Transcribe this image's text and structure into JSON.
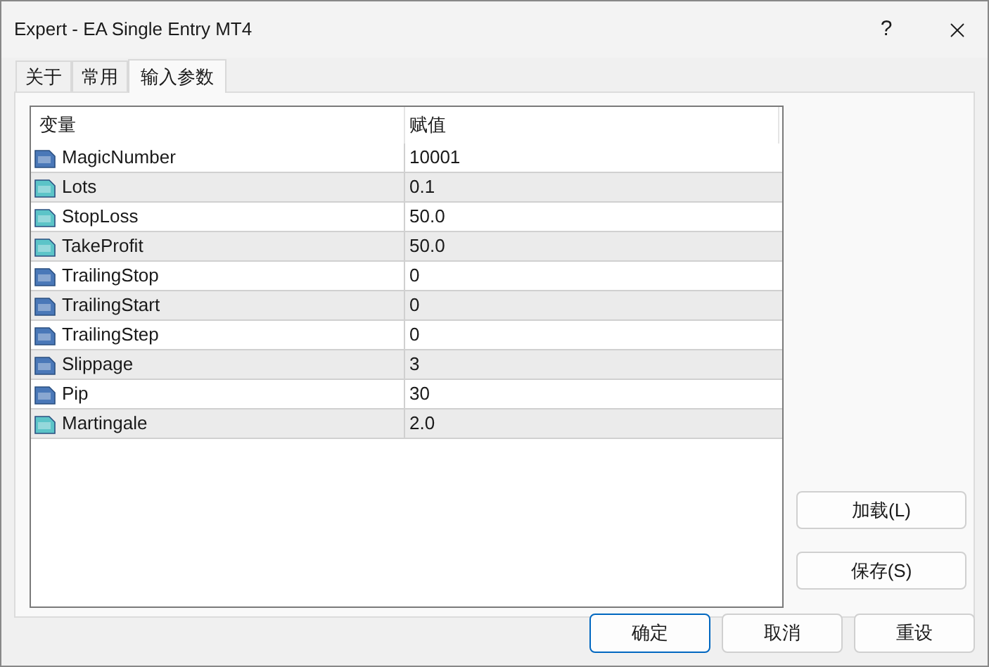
{
  "window": {
    "title": "Expert - EA Single Entry MT4",
    "help": "?"
  },
  "tabs": [
    {
      "label": "关于",
      "selected": false
    },
    {
      "label": "常用",
      "selected": false
    },
    {
      "label": "输入参数",
      "selected": true
    }
  ],
  "table": {
    "columns": [
      "变量",
      "赋值"
    ],
    "rows": [
      {
        "kind": "integer",
        "name": "MagicNumber",
        "value": "10001"
      },
      {
        "kind": "decimal",
        "name": "Lots",
        "value": "0.1"
      },
      {
        "kind": "decimal",
        "name": "StopLoss",
        "value": "50.0"
      },
      {
        "kind": "decimal",
        "name": "TakeProfit",
        "value": "50.0"
      },
      {
        "kind": "integer",
        "name": "TrailingStop",
        "value": "0"
      },
      {
        "kind": "integer",
        "name": "TrailingStart",
        "value": "0"
      },
      {
        "kind": "integer",
        "name": "TrailingStep",
        "value": "0"
      },
      {
        "kind": "integer",
        "name": "Slippage",
        "value": "3"
      },
      {
        "kind": "integer",
        "name": "Pip",
        "value": "30"
      },
      {
        "kind": "decimal",
        "name": "Martingale",
        "value": "2.0"
      }
    ]
  },
  "side_buttons": [
    "加载(L)",
    "保存(S)"
  ],
  "buttons": [
    {
      "label": "确定",
      "default": true
    },
    {
      "label": "取消",
      "default": false
    },
    {
      "label": "重设",
      "default": false
    }
  ]
}
